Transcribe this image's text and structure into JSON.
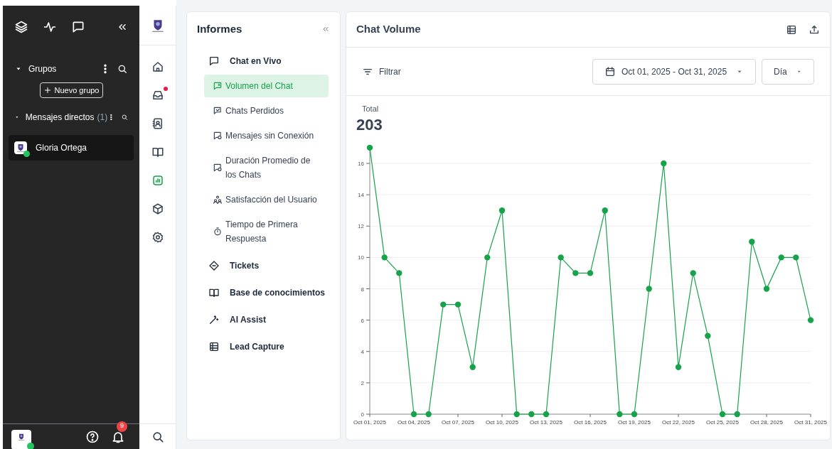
{
  "sidebar": {
    "sections": [
      {
        "title": "Grupos",
        "expanded": true,
        "action": "Nuevo grupo"
      },
      {
        "title": "Mensajes directos",
        "count": "(1)",
        "expanded": true
      }
    ],
    "contacts": [
      {
        "name": "Gloria Ortega",
        "online": true,
        "selected": true
      }
    ],
    "notifications_badge": "9"
  },
  "rail": {
    "items": [
      {
        "kind": "home",
        "selected": false,
        "alert": false
      },
      {
        "kind": "inbox",
        "selected": false,
        "alert": true
      },
      {
        "kind": "contacts",
        "selected": false,
        "alert": false
      },
      {
        "kind": "book",
        "selected": false,
        "alert": false
      },
      {
        "kind": "reports",
        "selected": true,
        "alert": false
      },
      {
        "kind": "box",
        "selected": false,
        "alert": false
      },
      {
        "kind": "settings",
        "selected": false,
        "alert": false
      }
    ]
  },
  "reports_menu": {
    "title": "Informes",
    "items": [
      {
        "label": "Chat en Vivo",
        "children": [
          {
            "label": "Volumen del Chat",
            "selected": true
          },
          {
            "label": "Chats Perdidos",
            "selected": false
          },
          {
            "label": "Mensajes sin Conexión",
            "selected": false
          },
          {
            "label": "Duración Promedio de los Chats",
            "selected": false
          },
          {
            "label": "Satisfacción del Usuario",
            "selected": false
          },
          {
            "label": "Tiempo de Primera Respuesta",
            "selected": false
          }
        ]
      },
      {
        "label": "Tickets"
      },
      {
        "label": "Base de conocimientos"
      },
      {
        "label": "AI Assist"
      },
      {
        "label": "Lead Capture"
      }
    ]
  },
  "report": {
    "title": "Chat Volume",
    "filter_label": "Filtrar",
    "date_range": "Oct 01, 2025 - Oct 31, 2025",
    "granularity": "Día",
    "total_value": "203",
    "chart_data": {
      "type": "line",
      "grid": true,
      "categories": [
        "Oct 01, 2025",
        null,
        null,
        "Oct 04, 2025",
        null,
        null,
        "Oct 07, 2025",
        null,
        null,
        "Oct 10, 2025",
        null,
        null,
        "Oct 13, 2025",
        null,
        null,
        "Oct 16, 2025",
        null,
        null,
        "Oct 19, 2025",
        null,
        null,
        "Oct 22, 2025",
        null,
        null,
        "Oct 25, 2025",
        null,
        null,
        "Oct 28, 2025",
        null,
        null,
        "Oct 31, 2025"
      ],
      "series": [
        {
          "name": "Total",
          "color": "#16a34a",
          "marker": "circle",
          "values": [
            17,
            10,
            9,
            0,
            0,
            7,
            7,
            3,
            10,
            13,
            0,
            0,
            0,
            10,
            9,
            9,
            13,
            0,
            0,
            8,
            16,
            3,
            9,
            5,
            0,
            0,
            11,
            8,
            10,
            10,
            6
          ]
        }
      ],
      "yticks": [
        0,
        2,
        4,
        6,
        8,
        10,
        12,
        14,
        16
      ],
      "ylim": [
        0,
        17
      ]
    }
  }
}
